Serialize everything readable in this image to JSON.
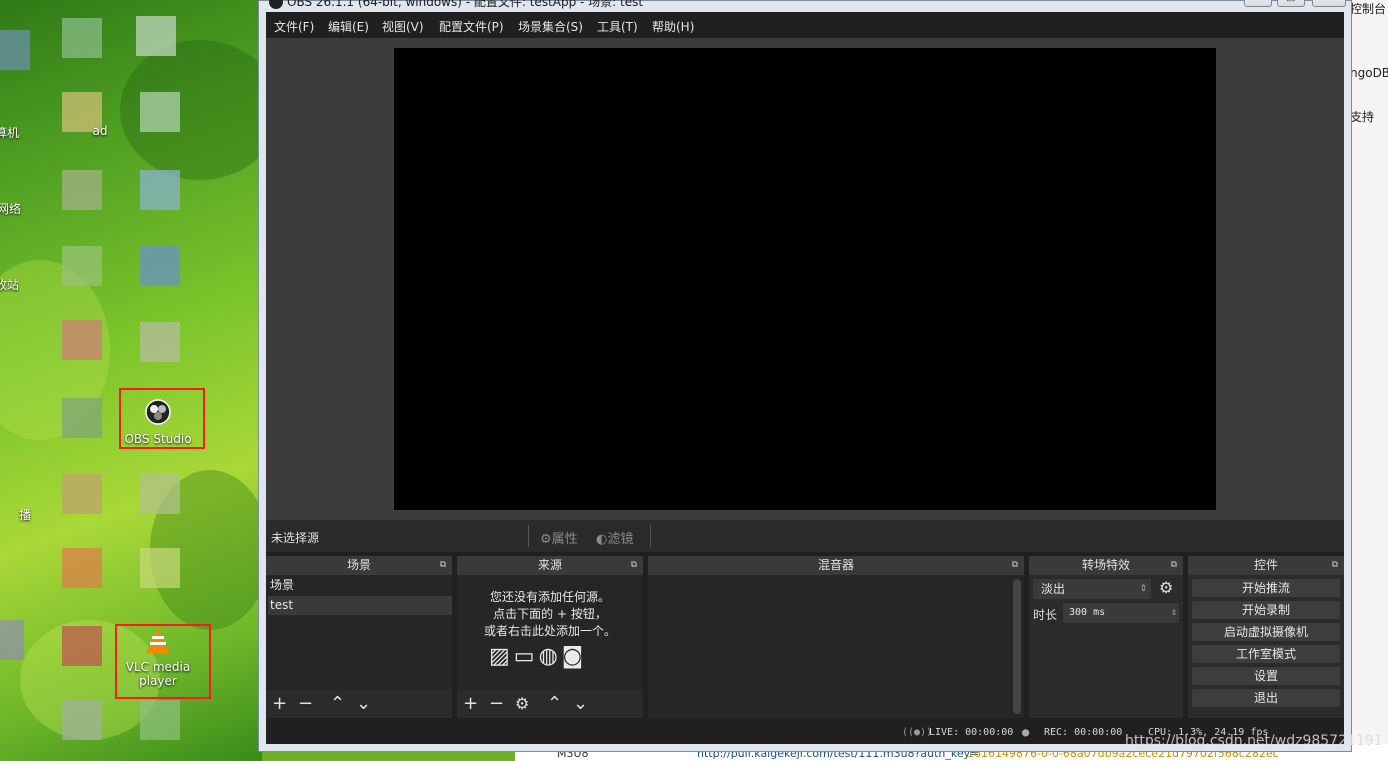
{
  "desktop": {
    "icons": [
      {
        "label": "OBS Studio"
      },
      {
        "label": "VLC media player"
      }
    ],
    "partial_labels": [
      "算机",
      "网络",
      "收站",
      "ad",
      "播"
    ]
  },
  "background_window": {
    "items": [
      "控制台",
      "ngoDB",
      "支持"
    ],
    "bottom_row": {
      "col1": "M3U8",
      "col2": "http://pull.kaigekeji.com/test/111.m3u8?auth_key=",
      "col3": "1616149876-0-0-68a07db9a2cece21d79702f568c282ec"
    }
  },
  "window": {
    "title": "OBS 26.1.1 (64-bit, windows) - 配置文件: testApp - 场景: test",
    "controls": [
      "—",
      "□",
      "✕"
    ]
  },
  "menu": [
    "文件(F)",
    "编辑(E)",
    "视图(V)",
    "配置文件(P)",
    "场景集合(S)",
    "工具(T)",
    "帮助(H)"
  ],
  "source_toolbar": {
    "no_source": "未选择源",
    "properties": "属性",
    "filters": "滤镜"
  },
  "docks": {
    "scenes": {
      "title": "场景",
      "items": [
        "场景",
        "test"
      ]
    },
    "sources": {
      "title": "来源",
      "hint": [
        "您还没有添加任何源。",
        "点击下面的 + 按钮，",
        "或者右击此处添加一个。"
      ]
    },
    "mixer": {
      "title": "混音器"
    },
    "transitions": {
      "title": "转场特效",
      "transition": "淡出",
      "duration_label": "时长",
      "duration_value": "300 ms"
    },
    "controls": {
      "title": "控件",
      "buttons": [
        "开始推流",
        "开始录制",
        "启动虚拟摄像机",
        "工作室模式",
        "设置",
        "退出"
      ]
    }
  },
  "status": {
    "live": "LIVE: 00:00:00",
    "rec": "REC: 00:00:00",
    "cpu": "CPU: 1.3%, 24.19 fps"
  },
  "watermark": "https://blog.csdn.net/wdz985721191",
  "colors": {
    "highlight_box": "#ff1a1a",
    "panel_bg": "#2b2b2b",
    "preview_bg": "#3c3c3c"
  }
}
